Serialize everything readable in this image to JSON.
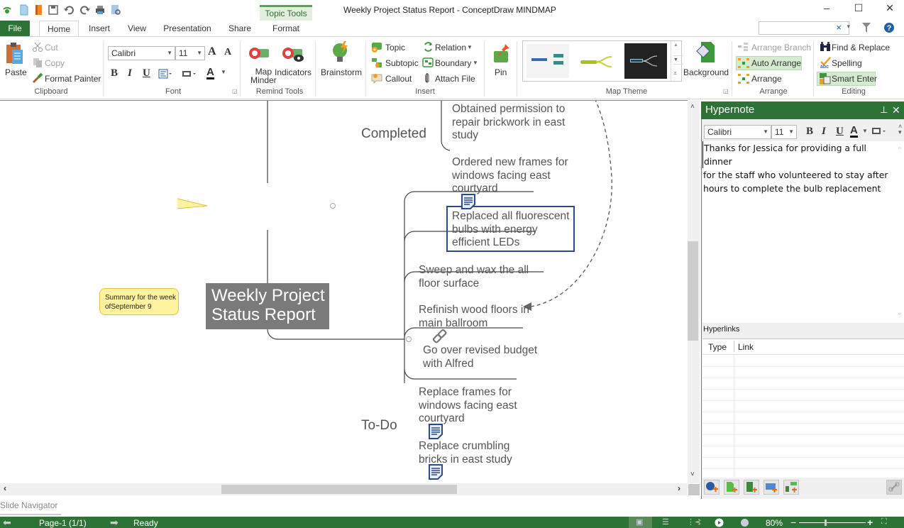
{
  "window": {
    "title": "Weekly Project Status Report - ConceptDraw MINDMAP",
    "contextual_tab_group": "Topic Tools",
    "controls": {
      "minimize": "–",
      "maximize": "☐",
      "close": "✕"
    }
  },
  "quick_access": [
    "app-logo-icon",
    "new-icon",
    "open-icon",
    "save-icon",
    "undo-icon",
    "redo-icon",
    "print-icon",
    "print-preview-icon"
  ],
  "tabs": [
    "File",
    "Home",
    "Insert",
    "View",
    "Presentation",
    "Share",
    "Format"
  ],
  "active_tab": "Home",
  "search": {
    "value": "",
    "clear": "×",
    "dropdown": "▾"
  },
  "ribbon": {
    "clipboard": {
      "label": "Clipboard",
      "paste": "Paste",
      "cut": "Cut",
      "copy": "Copy",
      "format_painter": "Format Painter"
    },
    "font": {
      "label": "Font",
      "family": "Calibri",
      "size": "11",
      "grow": "A",
      "shrink": "A",
      "bold": "B",
      "italic": "I",
      "underline": "U",
      "font_color": "A"
    },
    "remind_tools": {
      "label": "Remind Tools",
      "map_minder": "Map\nMinder",
      "map_minder_l1": "Map",
      "map_minder_l2": "Minder",
      "indicators": "Indicators"
    },
    "brainstorm": {
      "label": "Brainstorm"
    },
    "insert": {
      "label": "Insert",
      "topic": "Topic",
      "subtopic": "Subtopic",
      "callout": "Callout",
      "relation": "Relation",
      "boundary": "Boundary",
      "attach_file": "Attach  File"
    },
    "pin": {
      "label": "Pin"
    },
    "map_theme": {
      "label": "Map Theme",
      "background": "Background"
    },
    "arrange": {
      "label": "Arrange",
      "arrange_branch": "Arrange Branch",
      "auto_arrange": "Auto Arrange",
      "arrange": "Arrange"
    },
    "editing": {
      "label": "Editing",
      "find_replace": "Find & Replace",
      "spelling": "Spelling",
      "smart_enter": "Smart Enter"
    }
  },
  "mindmap": {
    "central": {
      "line1": "Weekly Project",
      "line2": "Status Report"
    },
    "callout": {
      "line1": "Summary for the week",
      "line2": "ofSeptember 9"
    },
    "branches": [
      {
        "label": "Completed",
        "topics": [
          {
            "lines": [
              "Obtained permission to",
              "repair brickwork in east",
              "study"
            ]
          },
          {
            "lines": [
              "Ordered new frames for",
              "windows facing east",
              "courtyard"
            ]
          },
          {
            "lines": [
              "Replaced all fluorescent",
              "bulbs with energy",
              "efficient LEDs"
            ],
            "selected": true,
            "has_note": true
          }
        ]
      },
      {
        "label": "To-Do",
        "topics": [
          {
            "lines": [
              "Sweep and wax the all",
              "floor surface"
            ]
          },
          {
            "lines": [
              "Refinish wood floors in",
              "main ballroom"
            ]
          },
          {
            "lines": [
              "Go over revised budget",
              "with Alfred"
            ],
            "has_link": true
          },
          {
            "lines": [
              "Replace frames for",
              "windows facing east",
              "courtyard"
            ]
          },
          {
            "lines": [
              "Replace crumbling",
              "bricks in east study"
            ],
            "has_note": true
          }
        ]
      }
    ]
  },
  "slide_navigator": "Slide Navigator",
  "hypernote": {
    "title": "Hypernote",
    "font_family": "Calibri",
    "font_size": "11",
    "text_lines": [
      "Thanks for Jessica for providing a full dinner",
      "for the staff who volunteered to stay after",
      "hours to complete the bulb replacement"
    ],
    "hyperlinks_label": "Hyperlinks",
    "columns": [
      "Type",
      "Link"
    ],
    "rows": []
  },
  "status": {
    "page": "Page-1 (1/1)",
    "state": "Ready",
    "zoom": "80%",
    "zoom_minus": "−",
    "zoom_plus": "+"
  }
}
